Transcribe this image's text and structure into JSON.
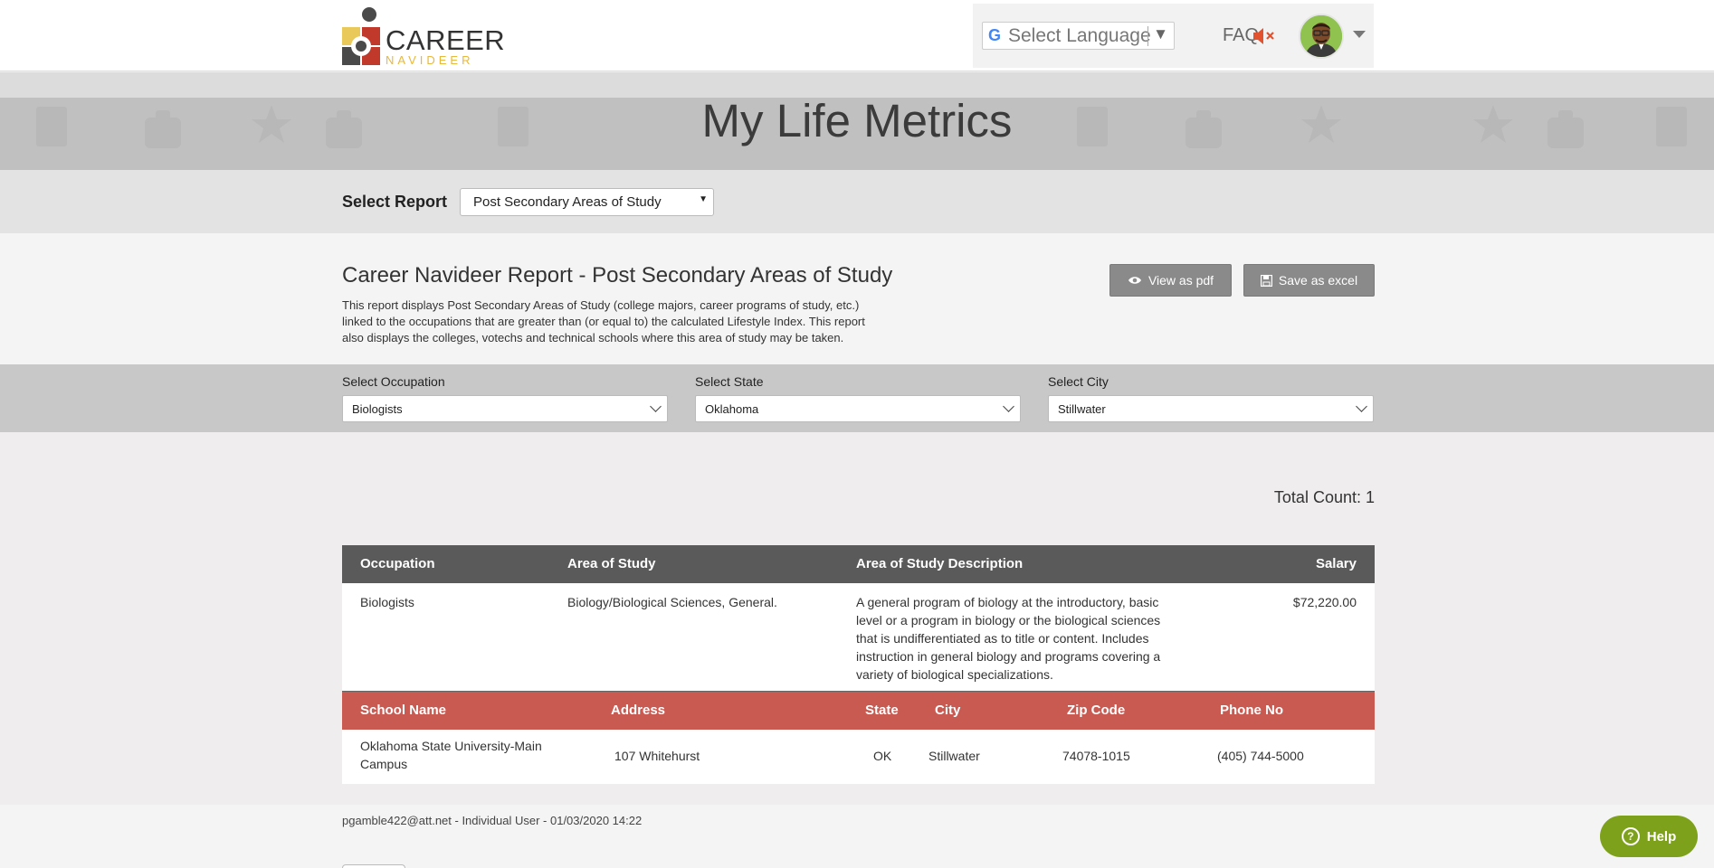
{
  "header": {
    "logo_word": "CAREER",
    "logo_sub": "NAVIDEER",
    "language_label": "Select Language",
    "faq_label": "FAQ"
  },
  "page_title": "My Life Metrics",
  "select_report": {
    "label": "Select Report",
    "value": "Post Secondary Areas of Study"
  },
  "report": {
    "title": "Career Navideer Report - Post Secondary Areas of Study",
    "description_lines": [
      "This report displays Post Secondary Areas of Study (college majors, career programs of study, etc.)",
      "linked to the occupations that are greater than (or equal to) the calculated Lifestyle Index. This report",
      "also displays the colleges, votechs and technical schools where this area of study may be taken."
    ],
    "view_pdf_label": "View as pdf",
    "save_excel_label": "Save as excel"
  },
  "filters": {
    "occupation": {
      "label": "Select Occupation",
      "value": "Biologists"
    },
    "state": {
      "label": "Select State",
      "value": "Oklahoma"
    },
    "city": {
      "label": "Select City",
      "value": "Stillwater"
    }
  },
  "total_count": "Total Count: 1",
  "occupation_table": {
    "headers": [
      "Occupation",
      "Area of Study",
      "Area of Study Description",
      "Salary"
    ],
    "row": {
      "occupation": "Biologists",
      "area": "Biology/Biological Sciences, General.",
      "description_lines": [
        "A general program of biology at the introductory, basic",
        "level or a program in biology or the biological sciences",
        "that is undifferentiated as to title or content. Includes",
        "instruction in general biology and programs covering a",
        "variety of biological specializations."
      ],
      "salary": "$72,220.00"
    }
  },
  "school_table": {
    "headers": [
      "School Name",
      "Address",
      "State",
      "City",
      "Zip Code",
      "Phone No"
    ],
    "row": {
      "school_lines": [
        "Oklahoma State University-Main",
        "Campus"
      ],
      "address": "107 Whitehurst",
      "state": "OK",
      "city": "Stillwater",
      "zip": "74078-1015",
      "phone": "(405) 744-5000"
    }
  },
  "footer": {
    "text": "pgamble422@att.net - Individual User - 01/03/2020 14:22"
  },
  "help_label": "Help",
  "colors": {
    "table_header_dark": "#5a5a5a",
    "table_header_red": "#c95a52",
    "help_green": "#7ea11b",
    "logo_yellow": "#e8b83b",
    "mute_red": "#e2522f"
  }
}
